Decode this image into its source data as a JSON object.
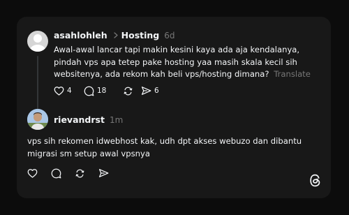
{
  "post": {
    "username": "asahlohleh",
    "topic": "Hosting",
    "time": "6d",
    "text": "Awal-awal lancar tapi makin kesini kaya ada aja kendalanya, pindah vps apa tetep pake hosting yaa masih skala kecil sih websitenya, ada rekom kah beli vps/hosting dimana?",
    "translate_label": "Translate",
    "likes": "4",
    "replies": "18",
    "shares": "6"
  },
  "reply": {
    "username": "rievandrst",
    "time": "1m",
    "text": "vps sih rekomen idwebhost kak, udh dpt akses webuzo dan dibantu migrasi sm setup awal vpsnya"
  },
  "icons": {
    "like": "heart-icon",
    "reply": "comment-icon",
    "repost": "repost-icon",
    "share": "send-icon",
    "chevron": "chevron-right-icon",
    "brand": "threads-logo-icon"
  },
  "colors": {
    "page_bg": "#0c0c0c",
    "card_bg": "#181818",
    "muted": "#777777",
    "text": "#f3f5f7"
  }
}
